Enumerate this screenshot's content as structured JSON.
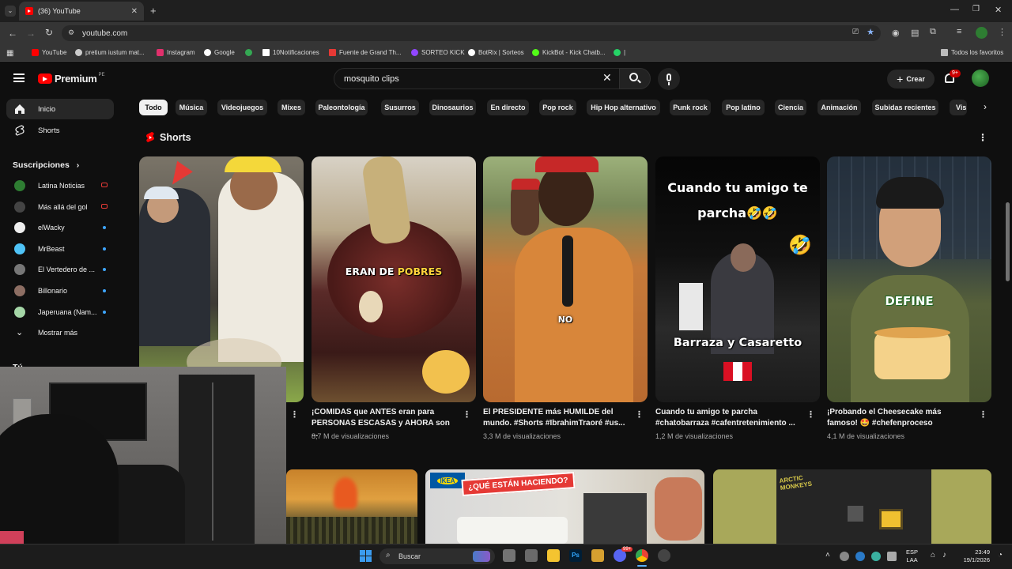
{
  "browser": {
    "tab_title": "(36) YouTube",
    "url": "youtube.com",
    "bookmarks": [
      {
        "label": "YouTube",
        "color": "#ff0000"
      },
      {
        "label": "pretium iustum mat...",
        "color": "#cccccc"
      },
      {
        "label": "Instagram",
        "color": "#e1306c"
      },
      {
        "label": "Google",
        "color": "#ffffff"
      },
      {
        "label": "",
        "color": "#34a853"
      },
      {
        "label": "10Notificaciones",
        "color": "#ffffff"
      },
      {
        "label": "Fuente de Grand Th...",
        "color": "#e53935"
      },
      {
        "label": "SORTEO KICK",
        "color": "#9146ff"
      },
      {
        "label": "BotRix | Sorteos",
        "color": "#ffffff"
      },
      {
        "label": "KickBot - Kick Chatb...",
        "color": "#53fc18"
      },
      {
        "label": "|",
        "color": "#25d366"
      }
    ],
    "all_bookmarks": "Todos los favoritos"
  },
  "header": {
    "logo": "Premium",
    "region": "PE",
    "search_value": "mosquito clips",
    "create_label": "Crear",
    "notif_count": "9+"
  },
  "chips": [
    "Todo",
    "Música",
    "Videojuegos",
    "Mixes",
    "Paleontología",
    "Susurros",
    "Dinosaurios",
    "En directo",
    "Pop rock",
    "Hip Hop alternativo",
    "Punk rock",
    "Pop latino",
    "Ciencia",
    "Animación",
    "Subidas recientes",
    "Vis"
  ],
  "sidebar": {
    "home": "Inicio",
    "shorts": "Shorts",
    "subs_title": "Suscripciones",
    "subs": [
      {
        "name": "Latina Noticias",
        "color": "#2e7d32",
        "live": true
      },
      {
        "name": "Más allá del gol",
        "color": "#444444",
        "live": true
      },
      {
        "name": "elWacky",
        "color": "#eeeeee",
        "live": false
      },
      {
        "name": "MrBeast",
        "color": "#4fc3f7",
        "live": false
      },
      {
        "name": "El Vertedero de ...",
        "color": "#777777",
        "live": false
      },
      {
        "name": "Billonario",
        "color": "#8d6e63",
        "live": false
      },
      {
        "name": "Japeruana (Nam...",
        "color": "#a5d6a7",
        "live": false
      }
    ],
    "more": "Mostrar más",
    "you": "Tú"
  },
  "shorts": {
    "title": "Shorts",
    "items": [
      {
        "title": "",
        "views": "",
        "overlay": ""
      },
      {
        "title": "¡COMIDAS que ANTES eran para PERSONAS ESCASAS y AHORA son ...",
        "views": "8,7 M de visualizaciones",
        "overlay": "ERAN DE POBRES",
        "overlay_a": "ERAN DE ",
        "overlay_b": "POBRES"
      },
      {
        "title": "El PRESIDENTE más HUMILDE del mundo. #Shorts #IbrahimTraoré #us...",
        "views": "3,3 M de visualizaciones",
        "overlay": "NO"
      },
      {
        "title": "Cuando tu amigo te parcha #chatobarraza #cafentretenimiento ...",
        "views": "1,2 M de visualizaciones",
        "overlay_top": "Cuando tu amigo te parcha🤣🤣",
        "overlay_bottom": "Barraza y Casaretto",
        "emoji": "🤣"
      },
      {
        "title": "¡Probando el Cheesecake más famoso! 🤩 #chefenproceso",
        "views": "4,1 M de visualizaciones",
        "overlay": "DEFINE"
      }
    ]
  },
  "row2": {
    "ikea_label": "IKEA",
    "ikea_banner": "¿QUÉ ESTÁN HACIENDO?",
    "poster_text": "ARCTIC MONKEYS"
  },
  "taskbar": {
    "search": "Buscar",
    "lang": "ESP",
    "lang2": "LAA",
    "time": "23:49",
    "date": "19/1/2026",
    "badge": "99+"
  }
}
